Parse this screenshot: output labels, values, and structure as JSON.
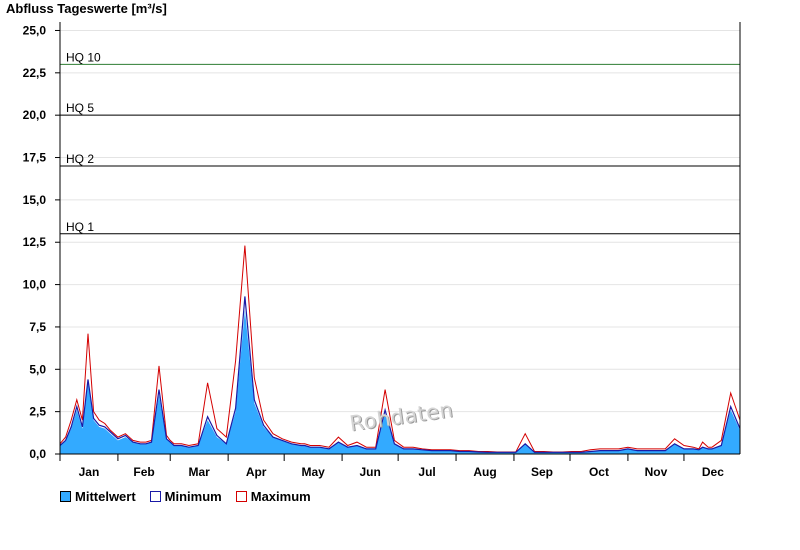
{
  "chart_data": {
    "type": "area",
    "title": "Abfluss Tageswerte [m³/s]",
    "ylim": [
      0,
      25.5
    ],
    "yticks": [
      "0,0",
      "2,5",
      "5,0",
      "7,5",
      "10,0",
      "12,5",
      "15,0",
      "17,5",
      "20,0",
      "22,5",
      "25,0"
    ],
    "categories": [
      "Jan",
      "Feb",
      "Mar",
      "Apr",
      "May",
      "Jun",
      "Jul",
      "Aug",
      "Sep",
      "Oct",
      "Nov",
      "Dec"
    ],
    "grid": true,
    "legend_position": "bottom-left",
    "thresholds": [
      {
        "label": "HQ 1",
        "value": 13.0,
        "color": "#000000"
      },
      {
        "label": "HQ 2",
        "value": 17.0,
        "color": "#000000"
      },
      {
        "label": "HQ 5",
        "value": 20.0,
        "color": "#000000"
      },
      {
        "label": "HQ 10",
        "value": 23.0,
        "color": "#2e7d32"
      }
    ],
    "x": [
      1,
      4,
      7,
      10,
      13,
      16,
      19,
      22,
      25,
      28,
      32,
      36,
      40,
      44,
      47,
      50,
      54,
      58,
      60,
      62,
      64,
      66,
      70,
      75,
      80,
      85,
      90,
      95,
      100,
      105,
      110,
      115,
      120,
      125,
      130,
      132,
      135,
      140,
      145,
      150,
      155,
      160,
      165,
      170,
      175,
      180,
      185,
      190,
      195,
      200,
      205,
      210,
      215,
      220,
      225,
      230,
      235,
      240,
      245,
      250,
      255,
      260,
      265,
      270,
      275,
      280,
      285,
      290,
      295,
      300,
      305,
      310,
      315,
      320,
      325,
      330,
      335,
      340,
      343,
      345,
      348,
      350,
      355,
      360,
      365
    ],
    "series": [
      {
        "name": "Mittelwert",
        "color": "#33aaff",
        "values": [
          0.5,
          0.8,
          1.5,
          2.6,
          1.5,
          4.2,
          2.0,
          1.6,
          1.5,
          1.2,
          0.8,
          1.0,
          0.7,
          0.6,
          0.6,
          0.7,
          3.5,
          0.9,
          0.7,
          0.5,
          0.5,
          0.5,
          0.4,
          0.5,
          2.0,
          1.0,
          0.6,
          2.5,
          8.5,
          3.0,
          1.6,
          1.0,
          0.8,
          0.6,
          0.5,
          0.5,
          0.4,
          0.4,
          0.3,
          0.7,
          0.4,
          0.5,
          0.3,
          0.3,
          2.4,
          0.6,
          0.3,
          0.3,
          0.25,
          0.2,
          0.2,
          0.2,
          0.15,
          0.15,
          0.12,
          0.1,
          0.1,
          0.1,
          0.1,
          0.6,
          0.1,
          0.1,
          0.1,
          0.1,
          0.1,
          0.1,
          0.15,
          0.2,
          0.2,
          0.2,
          0.3,
          0.2,
          0.2,
          0.2,
          0.2,
          0.6,
          0.3,
          0.3,
          0.25,
          0.4,
          0.3,
          0.3,
          0.5,
          2.6,
          1.4,
          1.0,
          1.2,
          0.6,
          0.4
        ]
      },
      {
        "name": "Minimum",
        "color": "#1a1aa6",
        "values": [
          0.5,
          0.8,
          1.6,
          2.8,
          1.6,
          4.4,
          2.1,
          1.7,
          1.6,
          1.3,
          0.9,
          1.1,
          0.7,
          0.6,
          0.6,
          0.7,
          3.8,
          0.9,
          0.7,
          0.5,
          0.5,
          0.5,
          0.4,
          0.5,
          2.2,
          1.1,
          0.6,
          2.7,
          9.3,
          3.2,
          1.7,
          1.0,
          0.8,
          0.6,
          0.5,
          0.5,
          0.4,
          0.4,
          0.3,
          0.7,
          0.4,
          0.5,
          0.3,
          0.3,
          2.6,
          0.6,
          0.3,
          0.3,
          0.25,
          0.2,
          0.2,
          0.2,
          0.15,
          0.15,
          0.12,
          0.1,
          0.1,
          0.1,
          0.1,
          0.6,
          0.1,
          0.1,
          0.1,
          0.1,
          0.1,
          0.1,
          0.15,
          0.2,
          0.2,
          0.2,
          0.3,
          0.2,
          0.2,
          0.2,
          0.2,
          0.6,
          0.3,
          0.3,
          0.25,
          0.4,
          0.3,
          0.3,
          0.5,
          2.8,
          1.5,
          1.1,
          1.3,
          0.6,
          0.4
        ]
      },
      {
        "name": "Maximum",
        "color": "#d40000",
        "values": [
          0.6,
          1.0,
          2.0,
          3.2,
          2.0,
          7.1,
          2.5,
          2.0,
          1.8,
          1.4,
          1.0,
          1.2,
          0.8,
          0.7,
          0.7,
          0.8,
          5.2,
          1.1,
          0.8,
          0.6,
          0.6,
          0.6,
          0.5,
          0.6,
          4.2,
          1.5,
          1.0,
          5.5,
          12.3,
          4.5,
          2.0,
          1.2,
          0.9,
          0.7,
          0.6,
          0.6,
          0.5,
          0.5,
          0.4,
          1.0,
          0.5,
          0.7,
          0.4,
          0.4,
          3.8,
          0.8,
          0.4,
          0.4,
          0.3,
          0.25,
          0.25,
          0.25,
          0.2,
          0.2,
          0.15,
          0.15,
          0.12,
          0.12,
          0.12,
          1.2,
          0.15,
          0.15,
          0.12,
          0.12,
          0.15,
          0.15,
          0.25,
          0.3,
          0.3,
          0.3,
          0.4,
          0.3,
          0.3,
          0.3,
          0.3,
          0.9,
          0.5,
          0.4,
          0.3,
          0.7,
          0.4,
          0.4,
          0.8,
          3.6,
          2.0,
          1.4,
          1.5,
          0.8,
          0.5
        ]
      }
    ]
  },
  "watermark": "Rohdaten"
}
